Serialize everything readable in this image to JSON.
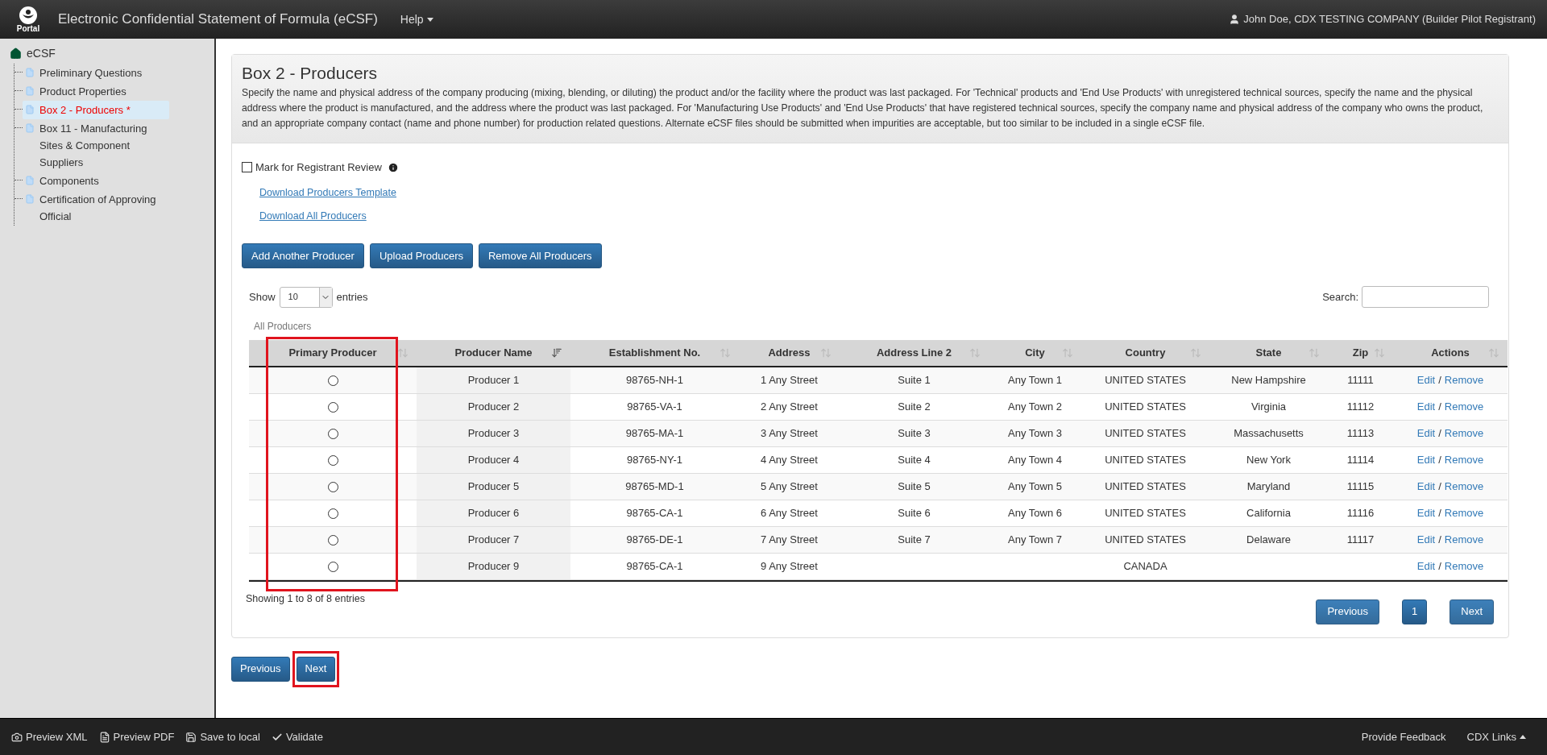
{
  "header": {
    "logo_text": "Portal",
    "title": "Electronic Confidential Statement of Formula (eCSF)",
    "menu": {
      "label": "Help"
    },
    "user": "John Doe, CDX TESTING COMPANY (Builder Pilot Registrant)"
  },
  "sidebar": {
    "root": "eCSF",
    "items": [
      {
        "label": "Preliminary Questions",
        "selected": false
      },
      {
        "label": "Product Properties",
        "selected": false
      },
      {
        "label": "Box 2 - Producers *",
        "selected": true
      },
      {
        "label": "Box 11 - Manufacturing Sites & Component Suppliers",
        "selected": false
      },
      {
        "label": "Components",
        "selected": false
      },
      {
        "label": "Certification of Approving Official",
        "selected": false
      }
    ]
  },
  "page": {
    "title": "Box 2 - Producers",
    "description": "Specify the name and physical address of the company producing (mixing, blending, or diluting) the product and/or the facility where the product was last packaged. For 'Technical' products and 'End Use Products' with unregistered technical sources, specify the name and the physical address where the product is manufactured, and the address where the product was last packaged. For 'Manufacturing Use Products' and 'End Use Products' that have registered technical sources, specify the company name and physical address of the company who owns the product, and an appropriate company contact (name and phone number) for production related questions. Alternate eCSF files should be submitted when impurities are acceptable, but too similar to be included in a single eCSF file.",
    "review": {
      "label": "Mark for Registrant Review",
      "checked": false
    },
    "links": [
      "Download Producers Template",
      "Download All Producers"
    ],
    "buttons": [
      "Add Another Producer",
      "Upload Producers",
      "Remove All Producers"
    ]
  },
  "table_controls": {
    "show_label": "Show",
    "page_size": "10",
    "entries_label": "entries",
    "search_label": "Search:"
  },
  "table": {
    "caption": "All Producers",
    "columns": [
      {
        "label": "Primary Producer",
        "sorted": false
      },
      {
        "label": "Producer Name",
        "sorted": true
      },
      {
        "label": "Establishment No.",
        "sorted": false
      },
      {
        "label": "Address",
        "sorted": false
      },
      {
        "label": "Address Line 2",
        "sorted": false
      },
      {
        "label": "City",
        "sorted": false
      },
      {
        "label": "Country",
        "sorted": false
      },
      {
        "label": "State",
        "sorted": false
      },
      {
        "label": "Zip",
        "sorted": false
      },
      {
        "label": "Actions",
        "sorted": false
      }
    ],
    "rows": [
      {
        "selected": false,
        "cells": [
          "",
          "Producer 1",
          "98765-NH-1",
          "1 Any Street",
          "Suite 1",
          "Any Town 1",
          "UNITED STATES",
          "New Hampshire",
          "11111"
        ],
        "edit": "Edit",
        "separator": "/",
        "remove": "Remove"
      },
      {
        "selected": false,
        "cells": [
          "",
          "Producer 2",
          "98765-VA-1",
          "2 Any Street",
          "Suite 2",
          "Any Town 2",
          "UNITED STATES",
          "Virginia",
          "11112"
        ],
        "edit": "Edit",
        "separator": "/",
        "remove": "Remove"
      },
      {
        "selected": false,
        "cells": [
          "",
          "Producer 3",
          "98765-MA-1",
          "3 Any Street",
          "Suite 3",
          "Any Town 3",
          "UNITED STATES",
          "Massachusetts",
          "11113"
        ],
        "edit": "Edit",
        "separator": "/",
        "remove": "Remove"
      },
      {
        "selected": false,
        "cells": [
          "",
          "Producer 4",
          "98765-NY-1",
          "4 Any Street",
          "Suite 4",
          "Any Town 4",
          "UNITED STATES",
          "New York",
          "11114"
        ],
        "edit": "Edit",
        "separator": "/",
        "remove": "Remove"
      },
      {
        "selected": false,
        "cells": [
          "",
          "Producer 5",
          "98765-MD-1",
          "5 Any Street",
          "Suite 5",
          "Any Town 5",
          "UNITED STATES",
          "Maryland",
          "11115"
        ],
        "edit": "Edit",
        "separator": "/",
        "remove": "Remove"
      },
      {
        "selected": false,
        "cells": [
          "",
          "Producer 6",
          "98765-CA-1",
          "6 Any Street",
          "Suite 6",
          "Any Town 6",
          "UNITED STATES",
          "California",
          "11116"
        ],
        "edit": "Edit",
        "separator": "/",
        "remove": "Remove"
      },
      {
        "selected": false,
        "cells": [
          "",
          "Producer 7",
          "98765-DE-1",
          "7 Any Street",
          "Suite 7",
          "Any Town 7",
          "UNITED STATES",
          "Delaware",
          "11117"
        ],
        "edit": "Edit",
        "separator": "/",
        "remove": "Remove"
      },
      {
        "selected": false,
        "cells": [
          "",
          "Producer 9",
          "98765-CA-1",
          "9 Any Street",
          "",
          "",
          "CANADA",
          "",
          ""
        ],
        "edit": "Edit",
        "separator": "/",
        "remove": "Remove"
      }
    ],
    "info": "Showing 1 to 8 of 8 entries",
    "pagination": [
      {
        "label": "Previous",
        "kind": "nav",
        "selected": false
      },
      {
        "label": "1",
        "kind": "page",
        "selected": true
      },
      {
        "label": "Next",
        "kind": "nav",
        "selected": false
      }
    ]
  },
  "step_nav": [
    "Previous",
    "Next"
  ],
  "footer": {
    "left": [
      "Preview XML",
      "Preview PDF",
      "Save to local",
      "Validate"
    ],
    "right": [
      "Provide Feedback",
      "CDX Links"
    ]
  }
}
